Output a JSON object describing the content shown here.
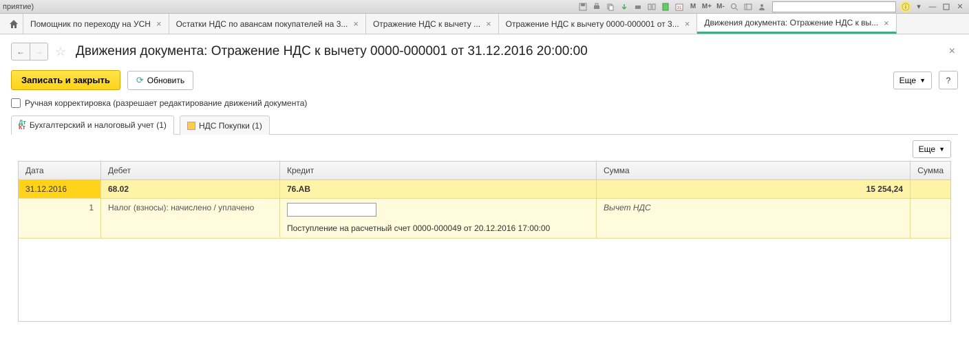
{
  "window_title": "приятие)",
  "tabs": [
    {
      "label": "Помощник по переходу на УСН"
    },
    {
      "label": "Остатки НДС по авансам покупателей на 3..."
    },
    {
      "label": "Отражение НДС к вычету ..."
    },
    {
      "label": "Отражение НДС к вычету 0000-000001 от 3..."
    },
    {
      "label": "Движения документа: Отражение НДС к вы..."
    }
  ],
  "page_title": "Движения документа: Отражение НДС к вычету 0000-000001 от 31.12.2016 20:00:00",
  "buttons": {
    "save_close": "Записать и закрыть",
    "refresh": "Обновить",
    "more": "Еще",
    "help": "?"
  },
  "checkbox_label": "Ручная корректировка (разрешает редактирование движений документа)",
  "subtabs": {
    "accounting": "Бухгалтерский и налоговый учет (1)",
    "vat": "НДС Покупки (1)"
  },
  "grid": {
    "headers": {
      "date": "Дата",
      "debit": "Дебет",
      "credit": "Кредит",
      "sum": "Сумма",
      "sum2": "Сумма"
    },
    "row1": {
      "date": "31.12.2016",
      "debit": "68.02",
      "credit": "76.АВ",
      "sum": "15 254,24"
    },
    "row2": {
      "num": "1",
      "debit": "Налог (взносы): начислено / уплачено",
      "credit_line": "Поступление на расчетный счет 0000-000049 от 20.12.2016 17:00:00",
      "sum": "Вычет НДС"
    }
  },
  "toolbar_icons": {
    "m": "M",
    "mplus": "M+",
    "mminus": "M-"
  }
}
